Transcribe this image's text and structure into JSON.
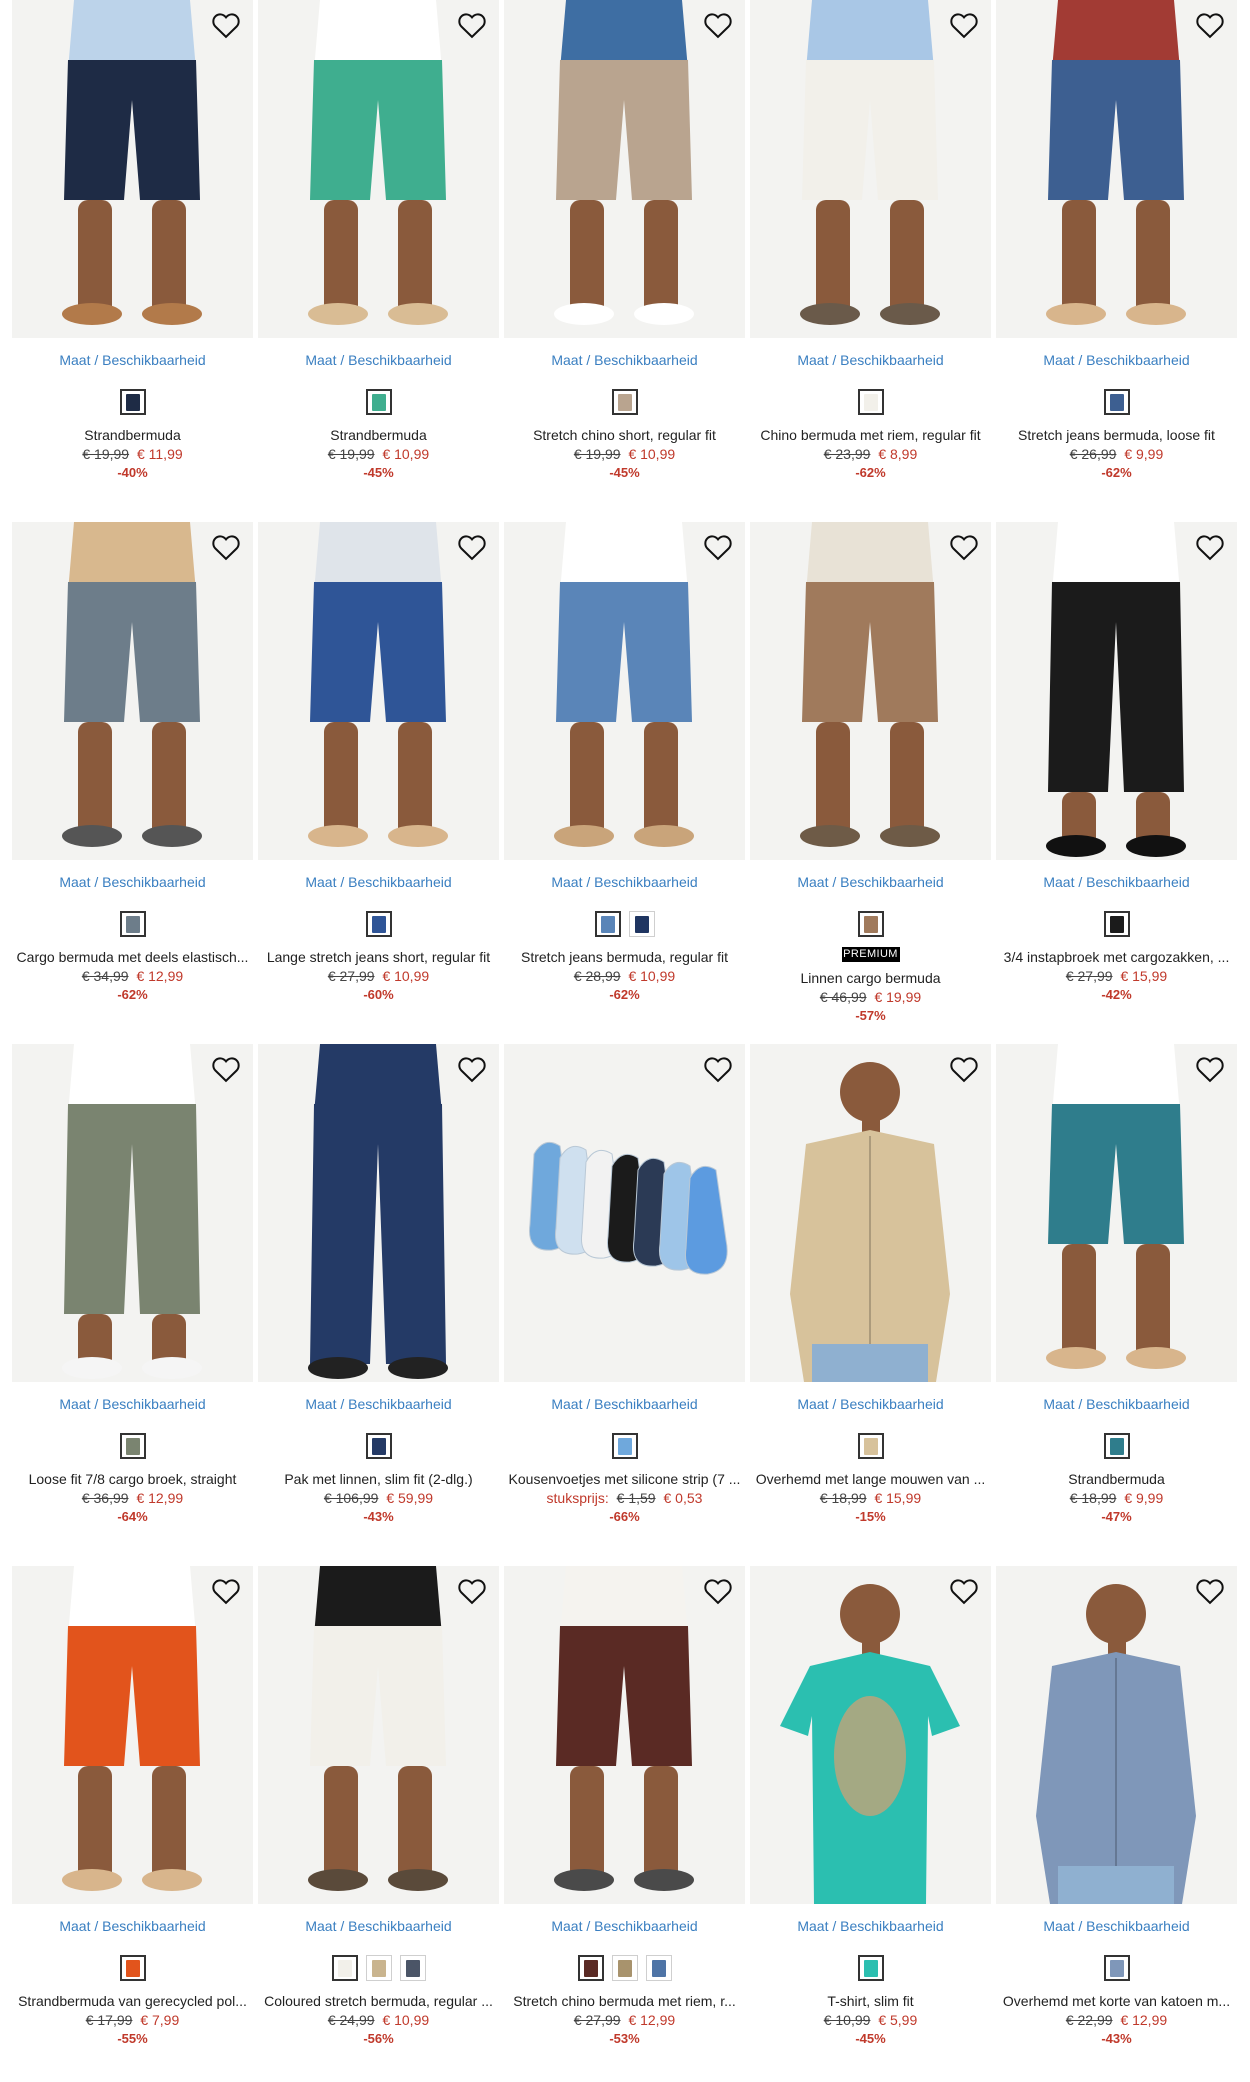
{
  "availability_label": "Maat / Beschikbaarheid",
  "premium_label": "PREMIUM",
  "colors": {
    "accent_link": "#3a7fc1",
    "sale_red": "#c0392b"
  },
  "products": [
    {
      "name": "Strandbermuda",
      "old_price": "€ 19,99",
      "new_price": "€ 11,99",
      "discount": "-40%",
      "swatches": [
        "#1e2b45"
      ],
      "top": "#bcd3ea",
      "bottom": "#1e2b45",
      "legs": "short",
      "footwear": "#b27a4a"
    },
    {
      "name": "Strandbermuda",
      "old_price": "€ 19,99",
      "new_price": "€ 10,99",
      "discount": "-45%",
      "swatches": [
        "#3fae8f"
      ],
      "top": "#ffffff",
      "bottom": "#3fae8f",
      "legs": "short",
      "footwear": "#d9bc94"
    },
    {
      "name": "Stretch chino short, regular fit",
      "old_price": "€ 19,99",
      "new_price": "€ 10,99",
      "discount": "-45%",
      "swatches": [
        "#b9a48f"
      ],
      "top": "#3e6ea3",
      "bottom": "#b9a48f",
      "legs": "short",
      "footwear": "#ffffff"
    },
    {
      "name": "Chino bermuda met riem, regular fit",
      "old_price": "€ 23,99",
      "new_price": "€ 8,99",
      "discount": "-62%",
      "swatches": [
        "#f2f0ea"
      ],
      "top": "#a9c7e6",
      "bottom": "#f2f0ea",
      "legs": "short",
      "footwear": "#6a5a4a"
    },
    {
      "name": "Stretch jeans bermuda, loose fit",
      "old_price": "€ 26,99",
      "new_price": "€ 9,99",
      "discount": "-62%",
      "swatches": [
        "#3d5f91"
      ],
      "top": "#a23b34",
      "bottom": "#3d5f91",
      "legs": "short",
      "footwear": "#d8b58c"
    },
    {
      "name": "Cargo bermuda met deels elastisch...",
      "old_price": "€ 34,99",
      "new_price": "€ 12,99",
      "discount": "-62%",
      "swatches": [
        "#6d7d8a"
      ],
      "top": "#d8b88e",
      "bottom": "#6d7d8a",
      "legs": "short",
      "footwear": "#555555"
    },
    {
      "name": "Lange stretch jeans short, regular fit",
      "old_price": "€ 27,99",
      "new_price": "€ 10,99",
      "discount": "-60%",
      "swatches": [
        "#2f5597"
      ],
      "top": "#dfe4ea",
      "bottom": "#2f5597",
      "legs": "short",
      "footwear": "#d8b58c"
    },
    {
      "name": "Stretch jeans bermuda, regular fit",
      "old_price": "€ 28,99",
      "new_price": "€ 10,99",
      "discount": "-62%",
      "swatches": [
        "#5a85b8",
        "#1f3561"
      ],
      "top": "#ffffff",
      "bottom": "#5a85b8",
      "legs": "short",
      "footwear": "#c9a47a"
    },
    {
      "name": "Linnen cargo bermuda",
      "old_price": "€ 46,99",
      "new_price": "€ 19,99",
      "discount": "-57%",
      "swatches": [
        "#a07a5c"
      ],
      "premium": true,
      "top": "#e8e2d6",
      "bottom": "#a07a5c",
      "legs": "short",
      "footwear": "#6e5b47"
    },
    {
      "name": "3/4 instapbroek met cargozakken, ...",
      "old_price": "€ 27,99",
      "new_price": "€ 15,99",
      "discount": "-42%",
      "swatches": [
        "#1b1b1b"
      ],
      "top": "#ffffff",
      "bottom": "#1b1b1b",
      "legs": "three",
      "footwear": "#111111"
    },
    {
      "name": "Loose fit 7/8 cargo broek, straight",
      "old_price": "€ 36,99",
      "new_price": "€ 12,99",
      "discount": "-64%",
      "swatches": [
        "#7a8470"
      ],
      "top": "#ffffff",
      "bottom": "#7a8470",
      "legs": "three",
      "footwear": "#f5f5f5"
    },
    {
      "name": "Pak met linnen, slim fit (2-dlg.)",
      "old_price": "€ 106,99",
      "new_price": "€ 59,99",
      "discount": "-43%",
      "swatches": [
        "#243a66"
      ],
      "top": "#243a66",
      "bottom": "#243a66",
      "legs": "long",
      "footwear": "#222222"
    },
    {
      "name": "Kousenvoetjes met silicone strip (7 ...",
      "unit_label": "stuksprijs:",
      "old_price": "€ 1,59",
      "new_price": "€ 0,53",
      "discount": "-66%",
      "swatches": [
        "#6fa8dc"
      ],
      "top": "",
      "bottom": "#6fa8dc",
      "legs": "socks",
      "footwear": ""
    },
    {
      "name": "Overhemd met lange mouwen van ...",
      "old_price": "€ 18,99",
      "new_price": "€ 15,99",
      "discount": "-15%",
      "swatches": [
        "#d7c29b"
      ],
      "top": "#d7c29b",
      "bottom": "#8fb0d0",
      "legs": "shirt",
      "footwear": ""
    },
    {
      "name": "Strandbermuda",
      "old_price": "€ 18,99",
      "new_price": "€ 9,99",
      "discount": "-47%",
      "swatches": [
        "#2f7d8c"
      ],
      "top": "#ffffff",
      "bottom": "#2f7d8c",
      "legs": "short",
      "footwear": "#d8b58c"
    },
    {
      "name": "Strandbermuda van gerecycled pol...",
      "old_price": "€ 17,99",
      "new_price": "€ 7,99",
      "discount": "-55%",
      "swatches": [
        "#e2541c"
      ],
      "top": "#ffffff",
      "bottom": "#e2541c",
      "legs": "short",
      "footwear": "#d8b58c"
    },
    {
      "name": "Coloured stretch bermuda, regular ...",
      "old_price": "€ 24,99",
      "new_price": "€ 10,99",
      "discount": "-56%",
      "swatches": [
        "#f2f0ea",
        "#c9b48e",
        "#4b5567"
      ],
      "top": "#1b1b1b",
      "bottom": "#f2f0ea",
      "legs": "short",
      "footwear": "#5a4a3a"
    },
    {
      "name": "Stretch chino bermuda met riem, r...",
      "old_price": "€ 27,99",
      "new_price": "€ 12,99",
      "discount": "-53%",
      "swatches": [
        "#5a2a24",
        "#a8936d",
        "#4e74a6"
      ],
      "top": "#f5f3ef",
      "bottom": "#5a2a24",
      "legs": "short",
      "footwear": "#4a4a4a"
    },
    {
      "name": "T-shirt, slim fit",
      "old_price": "€ 10,99",
      "new_price": "€ 5,99",
      "discount": "-45%",
      "swatches": [
        "#2bbfb0"
      ],
      "top": "#2bbfb0",
      "bottom": "",
      "legs": "tee",
      "footwear": ""
    },
    {
      "name": "Overhemd met korte van katoen m...",
      "old_price": "€ 22,99",
      "new_price": "€ 12,99",
      "discount": "-43%",
      "swatches": [
        "#7f97b9"
      ],
      "top": "#7f97b9",
      "bottom": "#8fb0d0",
      "legs": "shirt",
      "footwear": ""
    }
  ]
}
